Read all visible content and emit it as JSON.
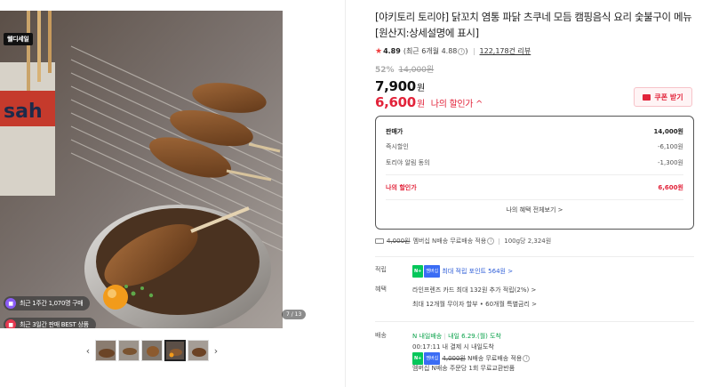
{
  "gallery": {
    "badge": "웰디세일",
    "pill_1": "최근 1주간 1,070명 구매",
    "pill_2": "최근 3일간 판매 BEST 상품",
    "counter": "7 / 13",
    "prev_icon": "chevron-left-icon",
    "next_icon": "chevron-right-icon",
    "thumb_count": 5,
    "active_thumb": 4
  },
  "product": {
    "title": "[야키토리 토리야] 닭꼬치 염통 파닭 츠쿠네 모듬 캠핑음식 요리 숯불구이 메뉴 [원산지:상세설명에 표시]",
    "rating": "4.89",
    "rating_detail": "(최근 6개월 4.88",
    "rating_detail_close": ")",
    "reviews": "122,178건 리뷰",
    "discount_pct": "52%",
    "original_price": "14,000원",
    "price": "7,900",
    "my_price": "6,600",
    "won": "원",
    "my_price_label": "나의 할인가 ^",
    "coupon_label": "쿠폰 받기"
  },
  "breakdown": {
    "rows": [
      {
        "label": "판매가",
        "value": "14,000원"
      },
      {
        "label": "즉시할인",
        "value": "-6,100원"
      },
      {
        "label": "토리야 알림 동의",
        "value": "-1,300원"
      }
    ],
    "mine_label": "나의 할인가",
    "mine_value": "6,600원",
    "view_all": "나의 혜택 전체보기 >"
  },
  "shipping_line": {
    "strike": "4,000원",
    "text": "멤버십 N배송 무료배송 적용",
    "per_unit": "100g당 2,324원"
  },
  "points": {
    "label": "적립",
    "npay": "N+",
    "member": "멤버십",
    "text": "최대 적립 포인트 564원 >"
  },
  "benefit": {
    "label": "혜택",
    "line1": "라인프렌즈 카드 최대 132원 추가 적립(2%) >",
    "line2": "최대 12개월 무이자 할부 • 60개월 특별금리 >"
  },
  "delivery": {
    "label": "배송",
    "arrive_badge": "N 내일배송",
    "arrive": "내일 6.29.(월) 도착",
    "timer": "00:17:11  내 결제 시 내일도착",
    "fee_strike": "4,000원",
    "fee_text": "N배송 무료배송 적용",
    "exchange": "멤버십 N배송 주문당 1회 무료교환반품"
  },
  "colors": {
    "accent_red": "#e2233a",
    "link_blue": "#2b5bd7",
    "npay_green": "#03c75a"
  }
}
